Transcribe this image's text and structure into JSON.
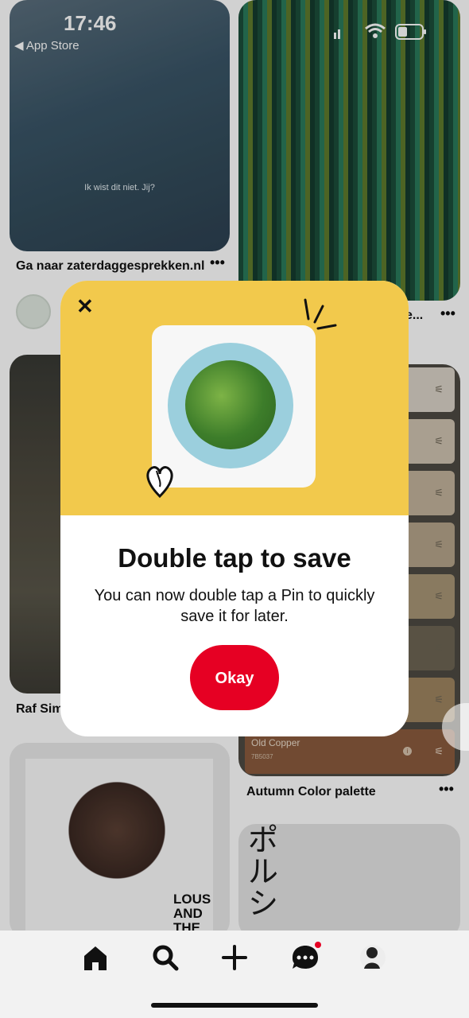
{
  "status_bar": {
    "time": "17:46",
    "back_label": "◀ App Store"
  },
  "feed": {
    "pins": [
      {
        "title": "Ga naar zaterdaggesprekken.nl",
        "subtitle_overlay": "Ik wist dit niet. Jij?"
      },
      {
        "title": "e..."
      },
      {
        "title": "Raf Sim"
      },
      {
        "title": "Autumn Color palette"
      }
    ],
    "palette": {
      "swatch_name": "Old Copper",
      "swatch_code": "7B5037"
    },
    "album_text": "LOUS AND THE YAKUZA",
    "porsche_text": "ポルシ"
  },
  "modal": {
    "title": "Double tap to save",
    "description": "You can now double tap a Pin to quickly save it for later.",
    "button_label": "Okay"
  },
  "nav": {
    "items": [
      "home-icon",
      "search-icon",
      "create-icon",
      "messages-icon",
      "profile-icon"
    ]
  },
  "colors": {
    "brand": "#e60023",
    "modal_top": "#f2c94c",
    "nav_bg": "#f2f2f2"
  }
}
